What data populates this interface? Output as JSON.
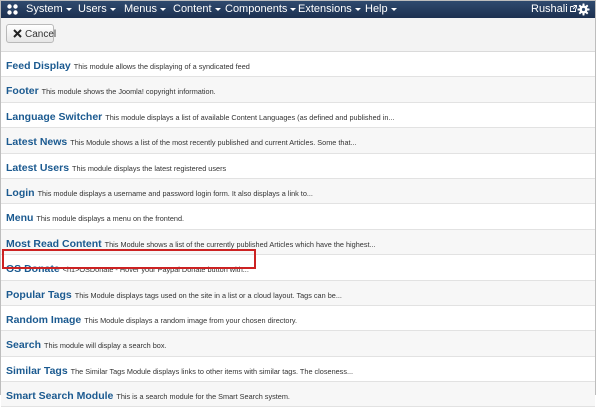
{
  "topbar": {
    "menu": [
      {
        "label": "System"
      },
      {
        "label": "Users"
      },
      {
        "label": "Menus"
      },
      {
        "label": "Content"
      },
      {
        "label": "Components"
      },
      {
        "label": "Extensions"
      },
      {
        "label": "Help"
      }
    ],
    "user": "Rushali"
  },
  "toolbar": {
    "cancel_label": "Cancel"
  },
  "modules": [
    {
      "title": "Feed Display",
      "description": "This module allows the displaying of a syndicated feed"
    },
    {
      "title": "Footer",
      "description": "This module shows the Joomla! copyright information."
    },
    {
      "title": "Language Switcher",
      "description": "This module displays a list of available Content Languages (as defined and published in..."
    },
    {
      "title": "Latest News",
      "description": "This Module shows a list of the most recently published and current Articles. Some that..."
    },
    {
      "title": "Latest Users",
      "description": "This module displays the latest registered users"
    },
    {
      "title": "Login",
      "description": "This module displays a username and password login form. It also displays a link to..."
    },
    {
      "title": "Menu",
      "description": "This module displays a menu on the frontend."
    },
    {
      "title": "Most Read Content",
      "description": "This Module shows a list of the currently published Articles which have the highest..."
    },
    {
      "title": "OS Donate",
      "description": "<h1>OSDonate - Hover your Paypal Donate button with..."
    },
    {
      "title": "Popular Tags",
      "description": "This Module displays tags used on the site in a list or a cloud layout. Tags can be..."
    },
    {
      "title": "Random Image",
      "description": "This Module displays a random image from your chosen directory."
    },
    {
      "title": "Search",
      "description": "This module will display a search box."
    },
    {
      "title": "Similar Tags",
      "description": "The Similar Tags Module displays links to other items with similar tags. The closeness..."
    },
    {
      "title": "Smart Search Module",
      "description": "This is a search module for the Smart Search system."
    }
  ],
  "icons": {
    "logo": "joomla-logo-icon",
    "external": "external-link-icon",
    "settings": "gear-icon",
    "cancel": "close-icon"
  },
  "colors": {
    "topbar": "#1c3050",
    "link": "#1b5a90",
    "highlight": "#cc2222"
  }
}
